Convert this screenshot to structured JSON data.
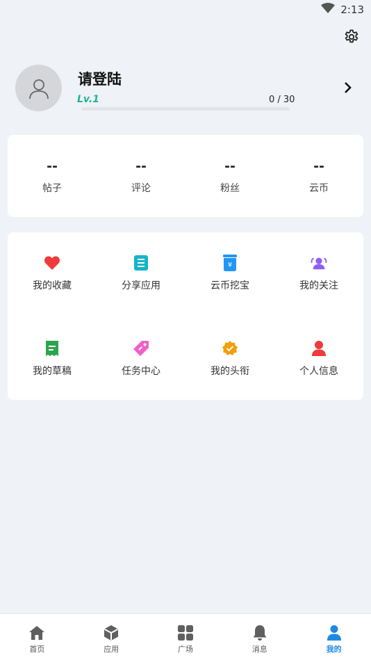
{
  "status_bar": {
    "time": "2:13",
    "icons": [
      "wifi-icon"
    ]
  },
  "header": {
    "settings_icon": "gear-icon"
  },
  "profile": {
    "name": "请登陆",
    "level": "Lv.1",
    "progress_text": "0 / 30",
    "progress": 0,
    "accent": "#1bb394"
  },
  "stats": [
    {
      "value": "--",
      "label": "帖子"
    },
    {
      "value": "--",
      "label": "评论"
    },
    {
      "value": "--",
      "label": "粉丝"
    },
    {
      "value": "--",
      "label": "云币"
    }
  ],
  "menu": [
    {
      "label": "我的收藏",
      "icon": "heart-icon",
      "color": "#ef3b3b"
    },
    {
      "label": "分享应用",
      "icon": "document-icon",
      "color": "#13b5c9"
    },
    {
      "label": "云币挖宝",
      "icon": "coin-jar-icon",
      "color": "#2196f3"
    },
    {
      "label": "我的关注",
      "icon": "group-icon",
      "color": "#8e5cf7"
    },
    {
      "label": "我的草稿",
      "icon": "draft-icon",
      "color": "#2da44e"
    },
    {
      "label": "任务中心",
      "icon": "tag-icon",
      "color": "#f060c6"
    },
    {
      "label": "我的头衔",
      "icon": "badge-icon",
      "color": "#f59e0b"
    },
    {
      "label": "个人信息",
      "icon": "person-icon",
      "color": "#ef3b3b"
    }
  ],
  "tabs": [
    {
      "label": "首页",
      "icon": "home-icon",
      "active": false
    },
    {
      "label": "应用",
      "icon": "cube-icon",
      "active": false
    },
    {
      "label": "广场",
      "icon": "grid-icon",
      "active": false
    },
    {
      "label": "消息",
      "icon": "bell-icon",
      "active": false
    },
    {
      "label": "我的",
      "icon": "user-icon",
      "active": true
    }
  ],
  "colors": {
    "tab_active": "#1e88e5",
    "tab_inactive": "#5f5f5f"
  }
}
